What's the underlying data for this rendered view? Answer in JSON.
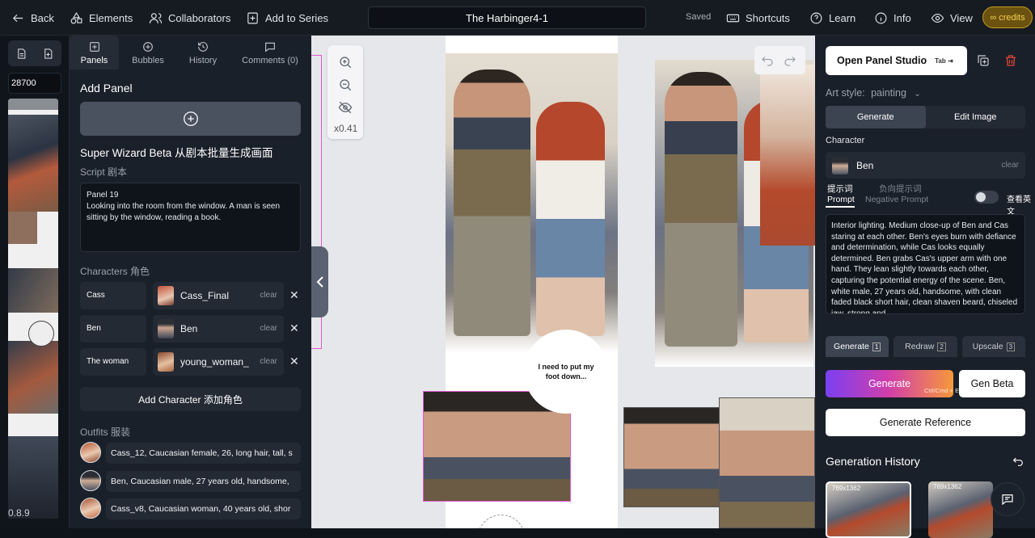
{
  "topbar": {
    "back": "Back",
    "elements": "Elements",
    "collaborators": "Collaborators",
    "add_to_series": "Add to Series",
    "title": "The Harbinger4-1",
    "saved": "Saved",
    "shortcuts": "Shortcuts",
    "learn": "Learn",
    "info": "Info",
    "view": "View",
    "credits": "credits"
  },
  "strip": {
    "count": "28700",
    "version": "0.8.9"
  },
  "left": {
    "tabs": [
      "Panels",
      "Bubbles",
      "History",
      "Comments (0)"
    ],
    "add_panel": "Add Panel",
    "super_wizard": "Super Wizard Beta 从剧本批量生成画面",
    "script_label": "Script 剧本",
    "script_text": "Panel 19\nLooking into the room from the window. A man is seen sitting by the window, reading a book.",
    "characters_label": "Characters 角色",
    "characters": [
      {
        "name": "Cass",
        "model": "Cass_Final",
        "clear": "clear"
      },
      {
        "name": "Ben",
        "model": "Ben",
        "clear": "clear"
      },
      {
        "name": "The woman",
        "model": "young_woman_",
        "clear": "clear"
      }
    ],
    "add_character": "Add Character 添加角色",
    "outfits_label": "Outfits 服装",
    "outfits": [
      "Cass_12, Caucasian female, 26, long hair, tall, s",
      "Ben, Caucasian male, 27 years old, handsome,",
      "Cass_v8, Caucasian woman, 40 years old, shor"
    ]
  },
  "canvas": {
    "zoom": "x0.41",
    "bubble_text": "I need to put my foot down..."
  },
  "right": {
    "open_studio": "Open Panel Studio",
    "open_studio_key": "Tab ⇥",
    "art_style_label": "Art style:",
    "art_style_value": "painting",
    "mode_tabs": [
      "Generate",
      "Edit Image"
    ],
    "character_label": "Character",
    "character_value": "Ben",
    "character_clear": "clear",
    "prompt_tab_cn": "提示词",
    "prompt_tab": "Prompt",
    "neg_prompt_tab_cn": "负向提示词",
    "neg_prompt_tab": "Negative Prompt",
    "english_toggle": "查看英文",
    "prompt_text": "Interior lighting. Medium close-up of Ben and Cas staring at each other. Ben's eyes burn with defiance and determination, while Cas looks equally determined. Ben grabs Cas's upper arm with one hand. They lean slightly towards each other, capturing the potential energy of the scene. Ben, white male, 27 years old, handsome, with clean faded black short hair, clean shaven beard, chiseled jaw, strong and",
    "gen_tabs": [
      {
        "label": "Generate",
        "key": "1"
      },
      {
        "label": "Redraw",
        "key": "2"
      },
      {
        "label": "Upscale",
        "key": "3"
      }
    ],
    "generate": "Generate",
    "generate_shortcut": "Ctrl/Cmd + Enter",
    "gen_beta": "Gen Beta",
    "generate_reference": "Generate Reference",
    "history_title": "Generation History",
    "history": [
      "769x1362",
      "769x1362"
    ]
  },
  "colors": {
    "accent_gradient_start": "#7b3ff2",
    "accent_gradient_end": "#f6983a",
    "selection": "#e05ad0",
    "credits": "#f6cf4e"
  }
}
